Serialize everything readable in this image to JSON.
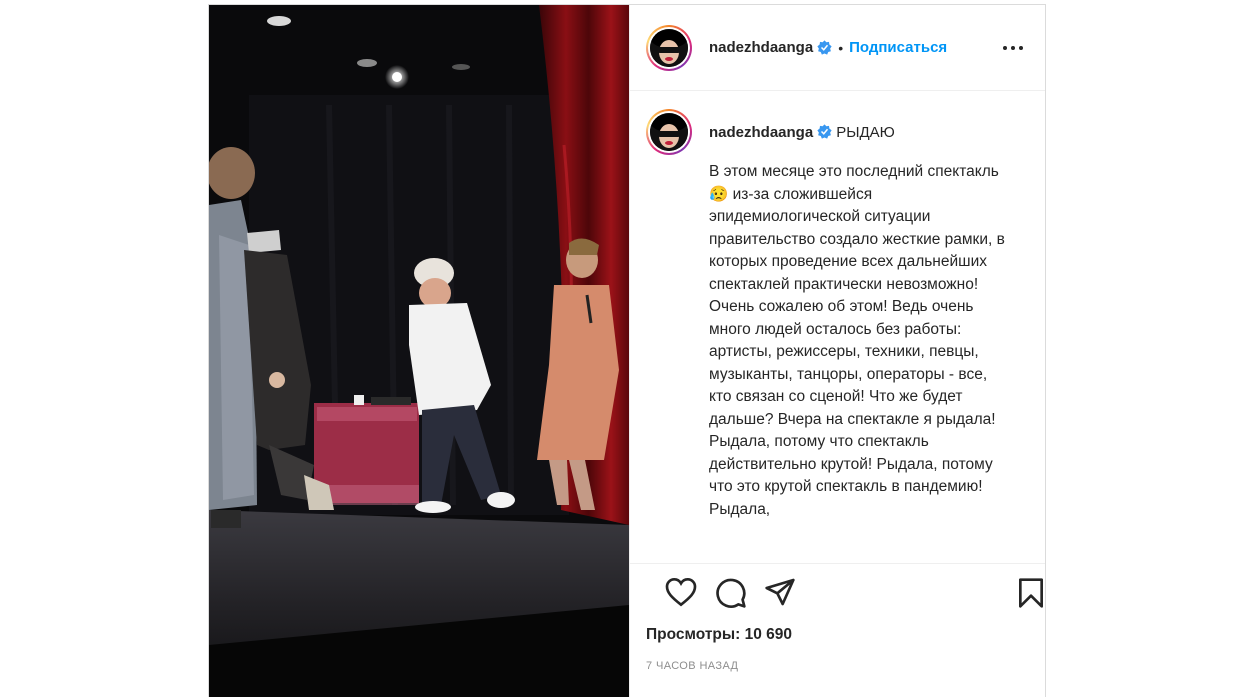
{
  "post": {
    "username": "nadezhdaanga",
    "verified": true,
    "follow_label": "Подписаться",
    "dot": "•",
    "caption_title": "РЫДАЮ",
    "caption_text": "В этом месяце это последний спектакль😥 из-за сложившейся эпидемиологической ситуации правительство создало жесткие рамки, в которых проведение всех дальнейших спектаклей практически невозможно! Очень сожалею об этом! Ведь очень много людей осталось без работы: артисты, режиссеры, техники, певцы, музыканты, танцоры, операторы - все, кто связан со сценой! Что же будет дальше? Вчера на спектакле я рыдала! Рыдала, потому что спектакль действительно крутой! Рыдала, потому что это крутой спектакль в пандемию! Рыдала,",
    "views": "Просмотры: 10 690",
    "time": "7 часов назад"
  },
  "icons": {
    "like": "heart-icon",
    "comment": "comment-icon",
    "share": "share-icon",
    "save": "bookmark-icon",
    "more": "more-options-icon",
    "verified": "verified-badge-icon"
  },
  "colors": {
    "accent": "#0095f6",
    "verified": "#3897f0",
    "text": "#262626",
    "muted": "#8e8e8e",
    "border": "#dbdbdb"
  }
}
